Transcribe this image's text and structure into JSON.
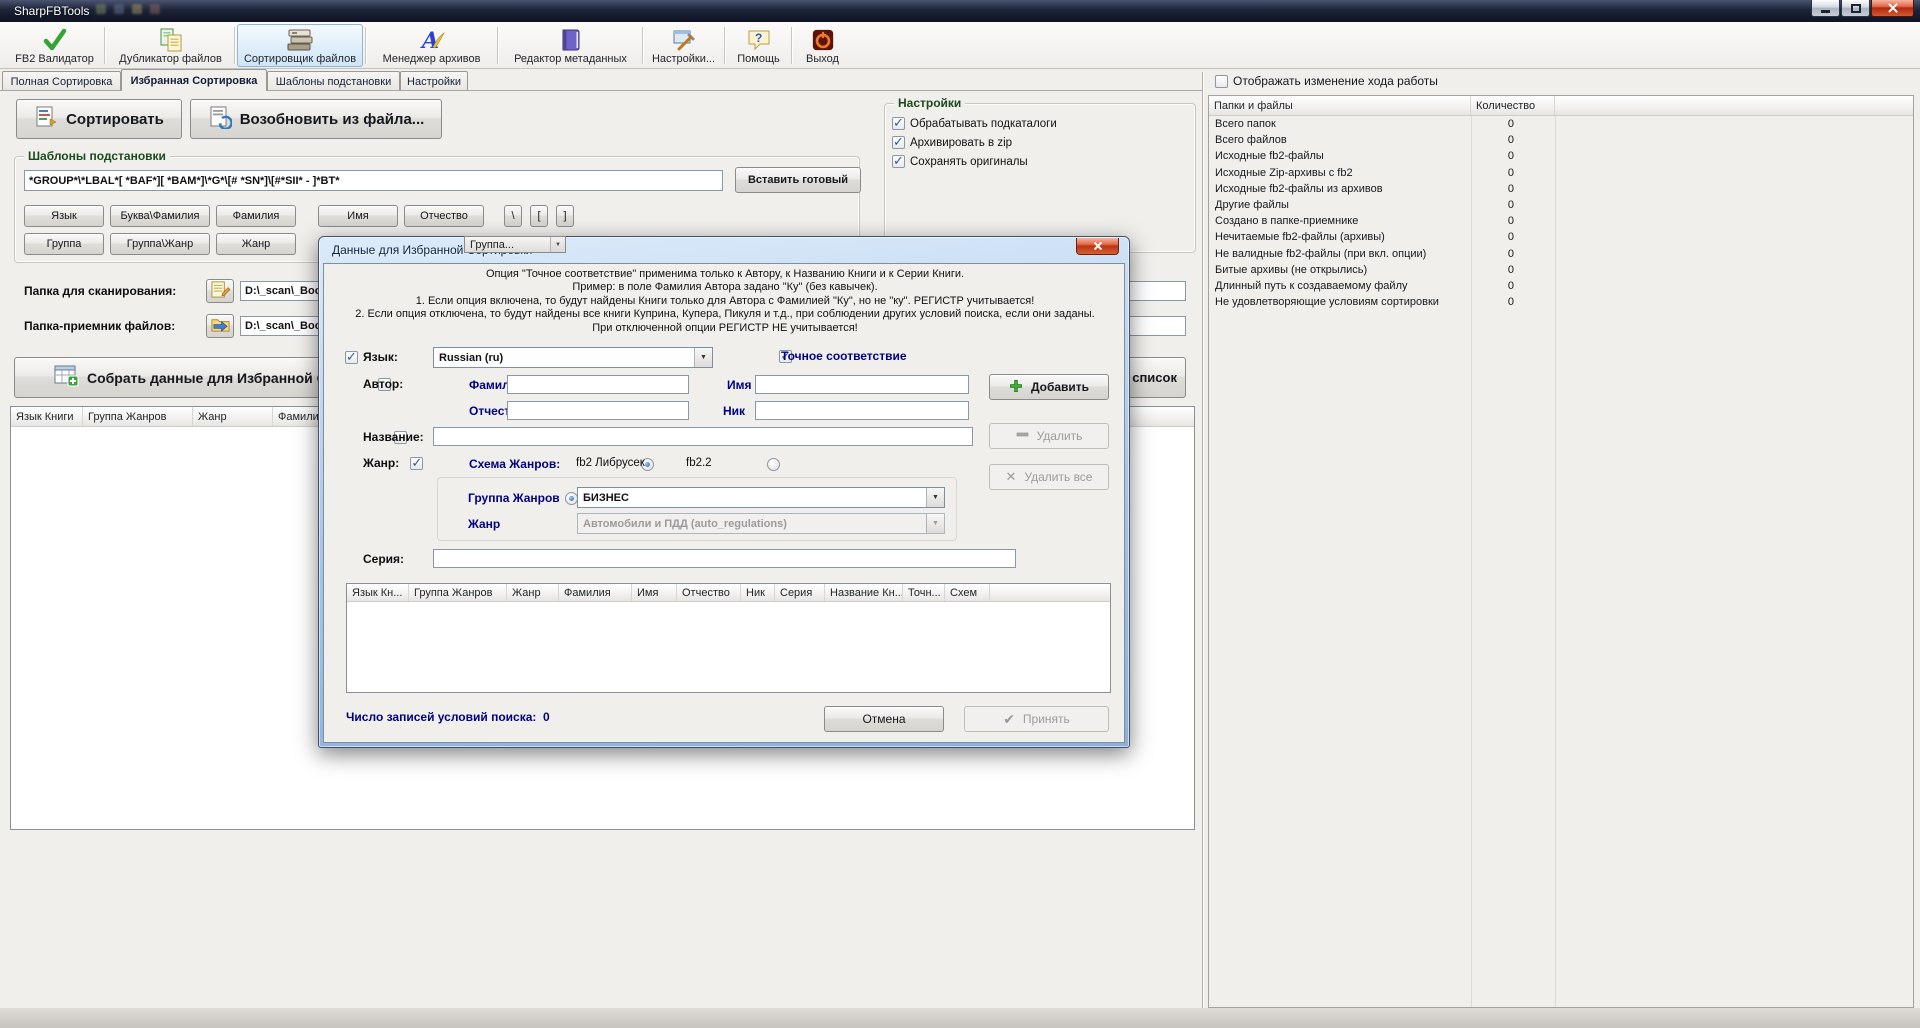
{
  "window": {
    "title": "SharpFBTools"
  },
  "toolbar": {
    "items": [
      {
        "label": "FB2 Валидатор",
        "icon": "check-icon",
        "selected": false
      },
      {
        "label": "Дубликатор файлов",
        "icon": "copy-files-icon",
        "selected": false
      },
      {
        "label": "Сортировщик файлов",
        "icon": "books-stack-icon",
        "selected": true
      },
      {
        "label": "Менеджер архивов",
        "icon": "archive-a-icon",
        "selected": false
      },
      {
        "label": "Редактор метаданных",
        "icon": "book-icon",
        "selected": false
      },
      {
        "label": "Настройки...",
        "icon": "tools-icon",
        "selected": false
      },
      {
        "label": "Помощь",
        "icon": "help-icon",
        "selected": false
      },
      {
        "label": "Выход",
        "icon": "exit-icon",
        "selected": false
      }
    ]
  },
  "tabs": [
    {
      "label": "Полная Сортировка",
      "active": false
    },
    {
      "label": "Избранная Сортировка",
      "active": true
    },
    {
      "label": "Шаблоны подстановки",
      "active": false
    },
    {
      "label": "Настройки",
      "active": false
    }
  ],
  "favorite_sort": {
    "sort_button": "Сортировать",
    "resume_button": "Возобновить из файла...",
    "templates_group": {
      "title": "Шаблоны подстановки",
      "template_value": "*GROUP*\\*LBAL*[ *BAF*][ *BAM*]\\*G*\\[# *SN*]\\[#*SII* - ]*BT*",
      "insert_ready_button": "Вставить готовый",
      "token_buttons_row1": [
        "Язык",
        "Буква\\Фамилия",
        "Фамилия",
        "Имя",
        "Отчество",
        "\\",
        "[",
        "]"
      ],
      "token_buttons_row2": [
        "Группа",
        "Группа\\Жанр",
        "Жанр"
      ]
    },
    "scan_folder_label": "Папка для сканирования:",
    "scan_folder_value": "D:\\_scan\\_Books",
    "target_folder_label": "Папка-приемник файлов:",
    "target_folder_value": "D:\\_scan\\_Books",
    "collect_button": "Собрать данные для Избранной Сортировки",
    "clear_list_button": "Очистить список",
    "books_table_columns": [
      "Язык Книги",
      "Группа Жанров",
      "Жанр",
      "Фамилия"
    ],
    "floating_fragment": "Группа..."
  },
  "settings_group": {
    "title": "Настройки",
    "checkboxes": [
      {
        "label": "Обрабатывать подкаталоги",
        "checked": true
      },
      {
        "label": "Архивировать в zip",
        "checked": true
      },
      {
        "label": "Сохранять оригиналы",
        "checked": true
      }
    ]
  },
  "progress_panel": {
    "show_progress_label": "Отображать изменение хода работы",
    "columns": [
      "Папки и файлы",
      "Количество"
    ],
    "rows": [
      {
        "label": "Всего папок",
        "value": "0"
      },
      {
        "label": "Всего файлов",
        "value": "0"
      },
      {
        "label": "Исходные fb2-файлы",
        "value": "0"
      },
      {
        "label": "Исходные Zip-архивы с fb2",
        "value": "0"
      },
      {
        "label": "Исходные fb2-файлы из архивов",
        "value": "0"
      },
      {
        "label": "Другие файлы",
        "value": "0"
      },
      {
        "label": "Создано в папке-приемнике",
        "value": "0"
      },
      {
        "label": "Нечитаемые fb2-файлы (архивы)",
        "value": "0"
      },
      {
        "label": "Не валидные fb2-файлы (при вкл. опции)",
        "value": "0"
      },
      {
        "label": "Битые архивы (не открылись)",
        "value": "0"
      },
      {
        "label": "Длинный путь к создаваемому файлу",
        "value": "0"
      },
      {
        "label": "Не удовлетворяющие условиям сортировки",
        "value": "0"
      }
    ]
  },
  "dialog": {
    "title": "Данные для Избранной Сортировки",
    "info_lines": [
      "Опция \"Точное соответствие\" применима только к Автору, к Названию Книги и к Серии Книги.",
      "Пример: в поле Фамилия Автора задано \"Ку\" (без кавычек).",
      "1. Если опция включена, то будут найдены Книги только для Автора с Фамилией \"Ку\", но не \"ку\". РЕГИСТР учитывается!",
      "2. Если опция отключена, то будут найдены все книги Куприна, Купера, Пикуля и т.д., при соблюдении других условий поиска, если они заданы.",
      "При отключенной опции РЕГИСТР НЕ учитывается!"
    ],
    "language_label": "Язык:",
    "language_value": "Russian (ru)",
    "exact_match_label": "Точное соответствие",
    "author_label": "Автор:",
    "author_last_name_label": "Фамилия",
    "author_first_name_label": "Имя",
    "author_middle_name_label": "Отчество",
    "author_nick_label": "Ник",
    "book_title_label": "Название:",
    "genre_label": "Жанр:",
    "genre_scheme_label": "Схема Жанров:",
    "scheme_librusek": "fb2 Либрусек",
    "scheme_fb22": "fb2.2",
    "genre_group_label": "Группа Жанров",
    "genre_group_value": "БИЗНЕС",
    "genre_item_label": "Жанр",
    "genre_item_value": "Автомобили и ПДД (auto_regulations)",
    "series_label": "Серия:",
    "table_columns": [
      "Язык Кн...",
      "Группа Жанров",
      "Жанр",
      "Фамилия",
      "Имя",
      "Отчество",
      "Ник",
      "Серия",
      "Название Кн...",
      "Точн...",
      "Схем"
    ],
    "records_count_label": "Число записей условий поиска:",
    "records_count_value": "0",
    "add_button": "Добавить",
    "delete_button": "Удалить",
    "delete_all_button": "Удалить все",
    "cancel_button": "Отмена",
    "accept_button": "Принять"
  },
  "colors": {
    "accent_navy": "#000080",
    "titlebar": "#161c2c",
    "group_title_green": "#1d4a1d",
    "dialog_caption_top": "#dcebfa",
    "dialog_caption_bottom": "#8cb0da",
    "close_button_red": "#bb3517",
    "check_green": "#33a433",
    "selected_tool_highlight": "#dcecf9"
  }
}
